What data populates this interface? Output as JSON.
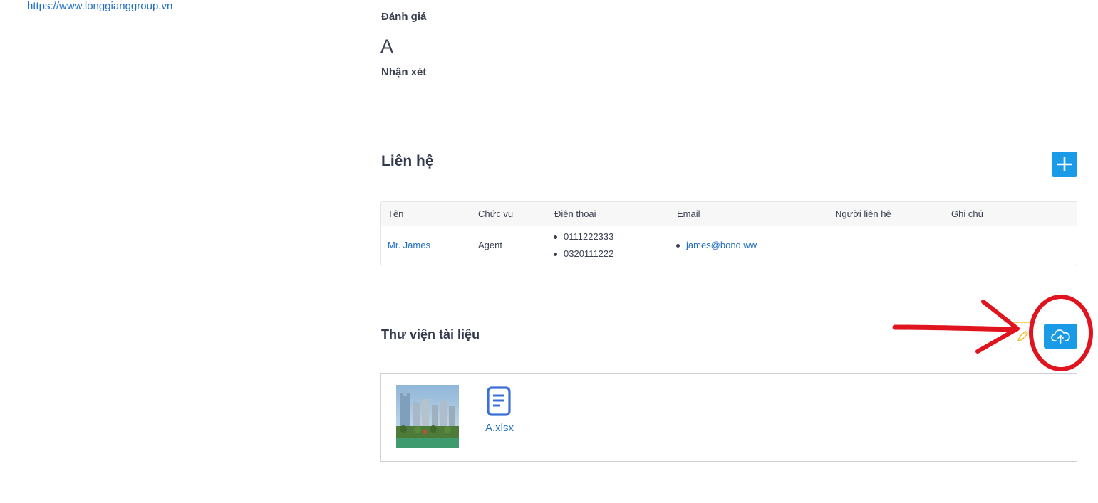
{
  "company": {
    "website": "https://www.longgianggroup.vn"
  },
  "evaluation": {
    "rating_label": "Đánh giá",
    "rating_value": "A",
    "comment_label": "Nhận xét"
  },
  "contacts": {
    "title": "Liên hệ",
    "add_icon": "plus-icon",
    "columns": [
      "Tên",
      "Chức vụ",
      "Điện thoại",
      "Email",
      "Người liên hệ",
      "Ghi chú"
    ],
    "rows": [
      {
        "name": "Mr. James",
        "position": "Agent",
        "phones": [
          "0111222333",
          "0320111222"
        ],
        "emails": [
          "james@bond.ww"
        ],
        "contact_person": "",
        "note": ""
      }
    ]
  },
  "library": {
    "title": "Thư viện tài liệu",
    "edit_icon": "pencil-icon",
    "upload_icon": "cloud-upload-icon",
    "files": [
      {
        "type": "image",
        "icon": "building-photo-thumbnail"
      },
      {
        "type": "document",
        "name": "A.xlsx",
        "icon": "document-icon"
      }
    ]
  },
  "annotation": {
    "color": "#e0141e",
    "marks": [
      "red-arrow",
      "red-circle"
    ]
  },
  "colors": {
    "primary": "#1a9be8",
    "link": "#1f6fc5",
    "warning_border": "#f5d25a"
  }
}
